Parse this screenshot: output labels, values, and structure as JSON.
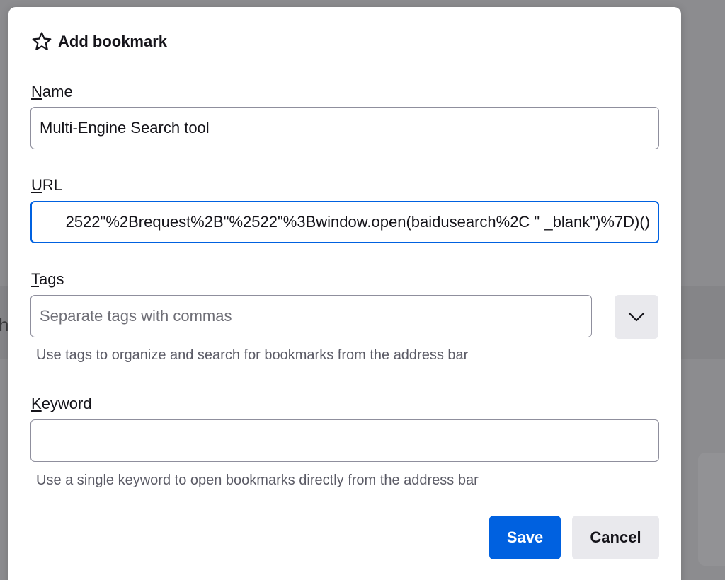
{
  "dialog": {
    "title": "Add bookmark",
    "icon": "star-icon"
  },
  "name_field": {
    "label_accesskey": "N",
    "label_rest": "ame",
    "value": "Multi-Engine Search tool"
  },
  "url_field": {
    "label_accesskey": "U",
    "label_rest": "RL",
    "value": "2522\"%2Brequest%2B\"%2522\"%3Bwindow.open(baidusearch%2C \" _blank\")%7D)()"
  },
  "tags_field": {
    "label_accesskey": "T",
    "label_rest": "ags",
    "placeholder": "Separate tags with commas",
    "hint": "Use tags to organize and search for bookmarks from the address bar",
    "dropdown_icon": "chevron-down-icon"
  },
  "keyword_field": {
    "label_accesskey": "K",
    "label_rest": "eyword",
    "value": "",
    "hint": "Use a single keyword to open bookmarks directly from the address bar"
  },
  "buttons": {
    "save": "Save",
    "cancel": "Cancel"
  },
  "background": {
    "partial_text": "h"
  },
  "colors": {
    "accent": "#0061e0",
    "button_secondary": "#e9e9ed",
    "backdrop": "#8c8c8f"
  }
}
